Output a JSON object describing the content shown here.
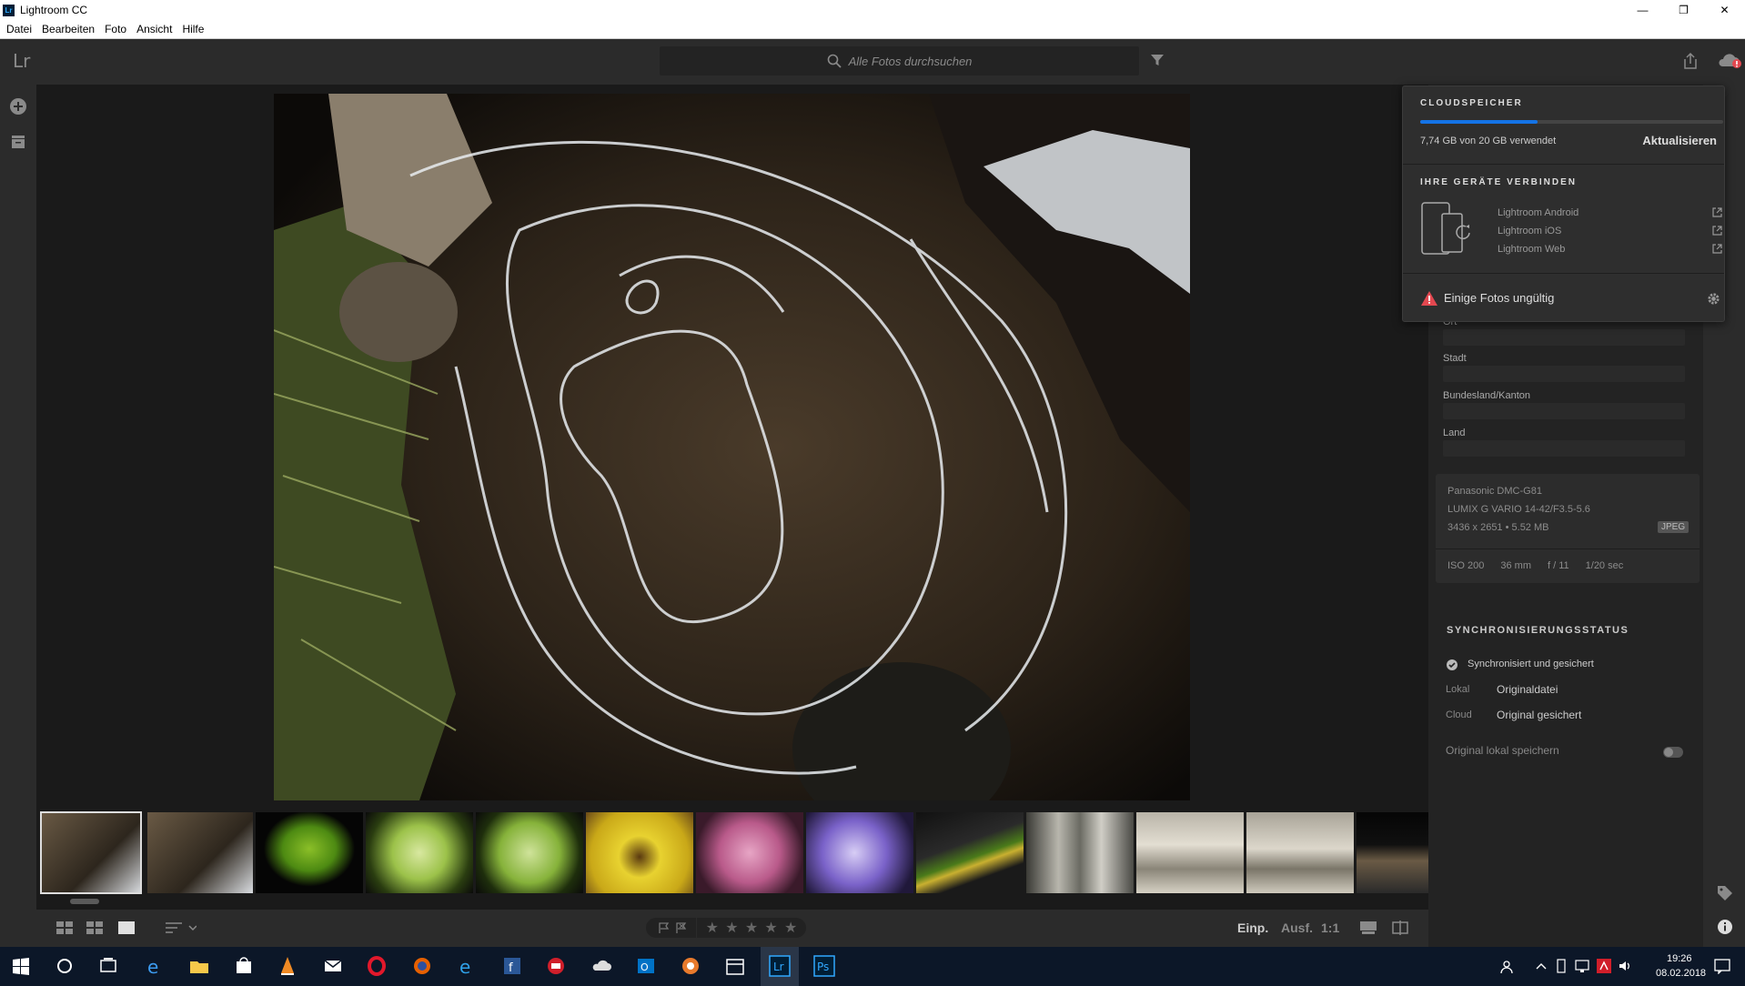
{
  "window": {
    "title": "Lightroom CC"
  },
  "menu": [
    "Datei",
    "Bearbeiten",
    "Foto",
    "Ansicht",
    "Hilfe"
  ],
  "app": {
    "logo": "Lr"
  },
  "search": {
    "placeholder": "Alle Fotos durchsuchen"
  },
  "cloud_popup": {
    "storage_title": "CLOUDSPEICHER",
    "storage_used_fraction": 0.387,
    "storage_text": "7,74 GB von 20 GB verwendet",
    "upgrade_label": "Aktualisieren",
    "devices_title": "IHRE GERÄTE VERBINDEN",
    "devices": [
      "Lightroom Android",
      "Lightroom iOS",
      "Lightroom Web"
    ],
    "warning": "Einige Fotos ungültig"
  },
  "info_panel": {
    "fields": [
      {
        "label": "Ort"
      },
      {
        "label": "Stadt"
      },
      {
        "label": "Bundesland/Kanton"
      },
      {
        "label": "Land"
      }
    ],
    "camera": "Panasonic DMC-G81",
    "lens": "LUMIX G VARIO 14-42/F3.5-5.6",
    "dimensions": "3436 x 2651 • 5.52 MB",
    "format": "JPEG",
    "exif": [
      "ISO 200",
      "36 mm",
      "f / 11",
      "1/20 sec"
    ]
  },
  "sync": {
    "title": "SYNCHRONISIERUNGSSTATUS",
    "status": "Synchronisiert und gesichert",
    "local_label": "Lokal",
    "local_value": "Originaldatei",
    "cloud_label": "Cloud",
    "cloud_value": "Original gesichert",
    "store_local_label": "Original lokal speichern"
  },
  "bottom": {
    "fit": "Einp.",
    "fill": "Ausf.",
    "ratio": "1:1"
  },
  "taskbar": {
    "time": "19:26",
    "date": "08.02.2018"
  },
  "colors": {
    "accent": "#1473e6",
    "background": "#1f1f1f",
    "panel": "#232323",
    "warning": "#e34850"
  }
}
